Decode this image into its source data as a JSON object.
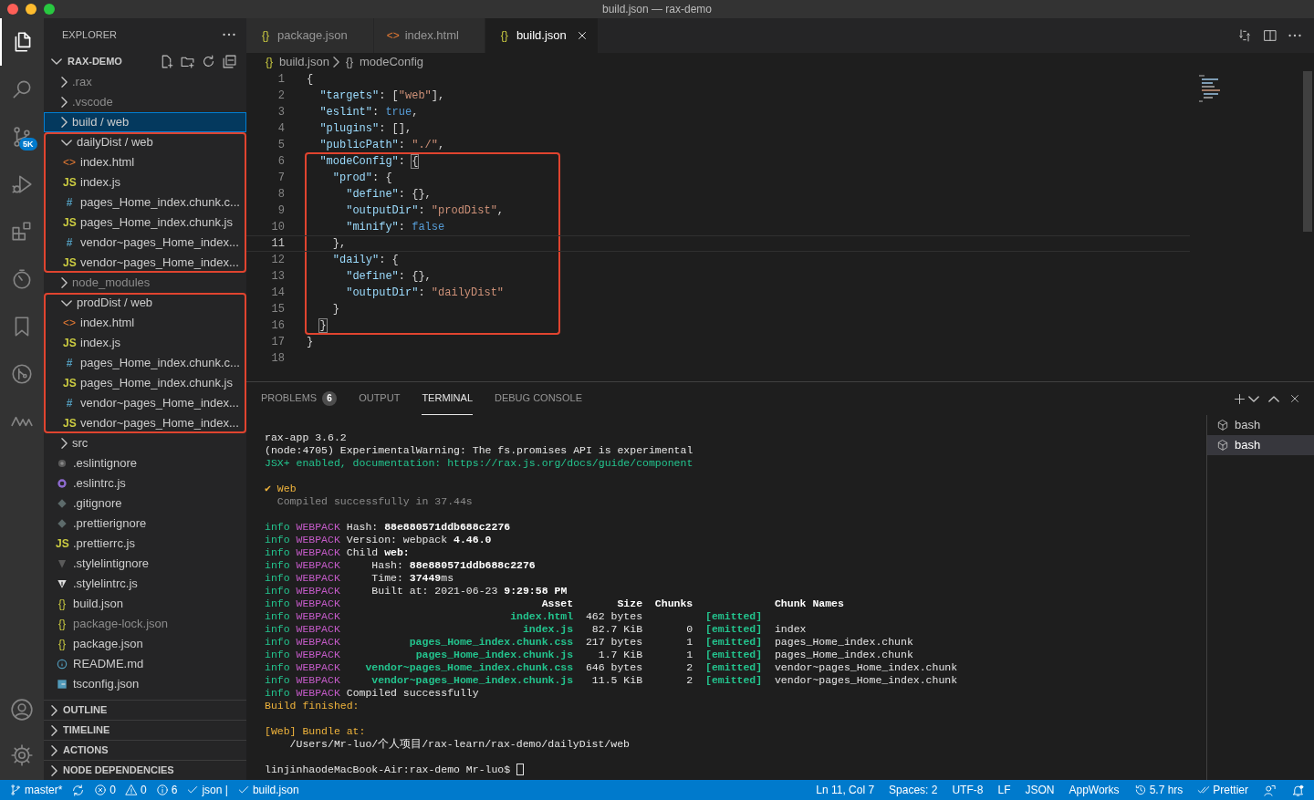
{
  "window": {
    "title": "build.json — rax-demo"
  },
  "activity_bar": {
    "items": [
      {
        "selected": true
      },
      {
        "selected": false
      },
      {
        "selected": false,
        "badge": "5K"
      },
      {
        "selected": false
      },
      {
        "selected": false
      },
      {
        "selected": false
      },
      {
        "selected": false
      },
      {
        "selected": false
      },
      {
        "selected": false
      }
    ]
  },
  "explorer": {
    "title": "EXPLORER",
    "project": {
      "name": "RAX-DEMO",
      "expanded": true
    },
    "tree": [
      {
        "kind": "folder",
        "name": ".rax",
        "expanded": false,
        "selected": false,
        "dimmed": true,
        "highlighted": false
      },
      {
        "kind": "folder",
        "name": ".vscode",
        "expanded": false,
        "selected": false,
        "dimmed": true,
        "highlighted": false
      },
      {
        "kind": "folder",
        "name": "build / web",
        "expanded": false,
        "selected": true,
        "dimmed": false,
        "highlighted": false
      },
      {
        "kind": "folder",
        "name": "dailyDist / web",
        "expanded": true,
        "selected": false,
        "dimmed": false,
        "highlighted": true,
        "children": [
          {
            "kind": "html",
            "name": "index.html",
            "glyph": "<>",
            "selected": false,
            "dimmed": false,
            "highlighted": false
          },
          {
            "kind": "js",
            "name": "index.js",
            "glyph": "JS",
            "selected": false,
            "dimmed": false,
            "highlighted": false
          },
          {
            "kind": "css",
            "name": "pages_Home_index.chunk.c...",
            "glyph": "#",
            "selected": false,
            "dimmed": false,
            "highlighted": false
          },
          {
            "kind": "js",
            "name": "pages_Home_index.chunk.js",
            "glyph": "JS",
            "selected": false,
            "dimmed": false,
            "highlighted": false
          },
          {
            "kind": "css",
            "name": "vendor~pages_Home_index...",
            "glyph": "#",
            "selected": false,
            "dimmed": false,
            "highlighted": false
          },
          {
            "kind": "js",
            "name": "vendor~pages_Home_index...",
            "glyph": "JS",
            "selected": false,
            "dimmed": false,
            "highlighted": false
          }
        ]
      },
      {
        "kind": "folder",
        "name": "node_modules",
        "expanded": false,
        "selected": false,
        "dimmed": true,
        "highlighted": false
      },
      {
        "kind": "folder",
        "name": "prodDist / web",
        "expanded": true,
        "selected": false,
        "dimmed": false,
        "highlighted": true,
        "children": [
          {
            "kind": "html",
            "name": "index.html",
            "glyph": "<>",
            "selected": false,
            "dimmed": false,
            "highlighted": false
          },
          {
            "kind": "js",
            "name": "index.js",
            "glyph": "JS",
            "selected": false,
            "dimmed": false,
            "highlighted": false
          },
          {
            "kind": "css",
            "name": "pages_Home_index.chunk.c...",
            "glyph": "#",
            "selected": false,
            "dimmed": false,
            "highlighted": false
          },
          {
            "kind": "js",
            "name": "pages_Home_index.chunk.js",
            "glyph": "JS",
            "selected": false,
            "dimmed": false,
            "highlighted": false
          },
          {
            "kind": "css",
            "name": "vendor~pages_Home_index...",
            "glyph": "#",
            "selected": false,
            "dimmed": false,
            "highlighted": false
          },
          {
            "kind": "js",
            "name": "vendor~pages_Home_index...",
            "glyph": "JS",
            "selected": false,
            "dimmed": false,
            "highlighted": false
          }
        ]
      },
      {
        "kind": "folder",
        "name": "src",
        "expanded": false,
        "selected": false,
        "dimmed": false,
        "highlighted": false
      },
      {
        "kind": "eslintignore",
        "name": ".eslintignore",
        "selected": false,
        "dimmed": false,
        "highlighted": false
      },
      {
        "kind": "eslint",
        "name": ".eslintrc.js",
        "selected": false,
        "dimmed": false,
        "highlighted": false
      },
      {
        "kind": "ignore",
        "name": ".gitignore",
        "selected": false,
        "dimmed": false,
        "highlighted": false
      },
      {
        "kind": "ignore",
        "name": ".prettierignore",
        "selected": false,
        "dimmed": false,
        "highlighted": false
      },
      {
        "kind": "js",
        "name": ".prettierrc.js",
        "glyph": "JS",
        "selected": false,
        "dimmed": false,
        "highlighted": false
      },
      {
        "kind": "stylelintignore",
        "name": ".stylelintignore",
        "selected": false,
        "dimmed": false,
        "highlighted": false
      },
      {
        "kind": "stylelint",
        "name": ".stylelintrc.js",
        "selected": false,
        "dimmed": false,
        "highlighted": false
      },
      {
        "kind": "json",
        "name": "build.json",
        "glyph": "{}",
        "selected": false,
        "dimmed": false,
        "highlighted": false
      },
      {
        "kind": "json",
        "name": "package-lock.json",
        "glyph": "{}",
        "selected": false,
        "dimmed": true,
        "highlighted": false
      },
      {
        "kind": "json",
        "name": "package.json",
        "glyph": "{}",
        "selected": false,
        "dimmed": false,
        "highlighted": false
      },
      {
        "kind": "readme",
        "name": "README.md",
        "selected": false,
        "dimmed": false,
        "highlighted": false
      },
      {
        "kind": "ts",
        "name": "tsconfig.json",
        "selected": false,
        "dimmed": false,
        "highlighted": false
      }
    ],
    "sections": [
      {
        "label": "OUTLINE",
        "expanded": false
      },
      {
        "label": "TIMELINE",
        "expanded": false
      },
      {
        "label": "ACTIONS",
        "expanded": false
      },
      {
        "label": "NODE DEPENDENCIES",
        "expanded": false
      }
    ]
  },
  "tabs": [
    {
      "label": "package.json",
      "kind": "json",
      "glyph": "{}",
      "selected": false
    },
    {
      "label": "index.html",
      "kind": "html",
      "glyph": "<>",
      "selected": false
    },
    {
      "label": "build.json",
      "kind": "json",
      "glyph": "{}",
      "selected": true
    }
  ],
  "breadcrumb": [
    {
      "label": "build.json",
      "kind": "json",
      "glyph": "{}"
    },
    {
      "label": "modeConfig",
      "kind": "object",
      "glyph": "{}"
    }
  ],
  "code": [
    {
      "number": "1",
      "current": false,
      "highlighted": false,
      "tokens": [
        {
          "t": "{",
          "kind": "p"
        }
      ]
    },
    {
      "number": "2",
      "current": false,
      "highlighted": false,
      "tokens": [
        {
          "t": "\"targets\"",
          "kind": "key"
        },
        {
          "t": ": [",
          "kind": "p"
        },
        {
          "t": "\"web\"",
          "kind": "str"
        },
        {
          "t": "],",
          "kind": "p"
        }
      ]
    },
    {
      "number": "3",
      "current": false,
      "highlighted": false,
      "tokens": [
        {
          "t": "\"eslint\"",
          "kind": "key"
        },
        {
          "t": ":",
          "kind": "p"
        },
        {
          "t": "true",
          "kind": "bool"
        },
        {
          "t": ",",
          "kind": "p"
        }
      ]
    },
    {
      "number": "4",
      "current": false,
      "highlighted": false,
      "tokens": [
        {
          "t": "\"plugins\"",
          "kind": "key"
        },
        {
          "t": ": [],",
          "kind": "p"
        }
      ]
    },
    {
      "number": "5",
      "current": false,
      "highlighted": false,
      "tokens": [
        {
          "t": "\"publicPath\"",
          "kind": "key"
        },
        {
          "t": ":",
          "kind": "p"
        },
        {
          "t": "\"./\"",
          "kind": "str"
        },
        {
          "t": ",",
          "kind": "p"
        }
      ]
    },
    {
      "number": "6",
      "current": false,
      "highlighted": true,
      "tokens": [
        {
          "t": "\"modeConfig\"",
          "kind": "key"
        },
        {
          "t": ":",
          "kind": "p"
        },
        {
          "t": "{",
          "kind": "match"
        }
      ]
    },
    {
      "number": "7",
      "current": false,
      "highlighted": true,
      "tokens": [
        {
          "t": "\"prod\"",
          "kind": "key"
        },
        {
          "t": ": {",
          "kind": "p"
        }
      ]
    },
    {
      "number": "8",
      "current": false,
      "highlighted": true,
      "tokens": [
        {
          "t": "\"define\"",
          "kind": "key"
        },
        {
          "t": ": {},",
          "kind": "p"
        }
      ]
    },
    {
      "number": "9",
      "current": false,
      "highlighted": true,
      "tokens": [
        {
          "t": "\"outputDir\"",
          "kind": "key"
        },
        {
          "t": ":",
          "kind": "p"
        },
        {
          "t": "\"prodDist\"",
          "kind": "str"
        },
        {
          "t": ",",
          "kind": "p"
        }
      ]
    },
    {
      "number": "10",
      "current": false,
      "highlighted": true,
      "tokens": [
        {
          "t": "\"minify\"",
          "kind": "key"
        },
        {
          "t": ":",
          "kind": "p"
        },
        {
          "t": "false",
          "kind": "bool"
        }
      ]
    },
    {
      "number": "11",
      "current": true,
      "highlighted": true,
      "tokens": [
        {
          "t": "},",
          "kind": "p"
        }
      ]
    },
    {
      "number": "12",
      "current": false,
      "highlighted": true,
      "tokens": [
        {
          "t": "\"daily\"",
          "kind": "key"
        },
        {
          "t": ": {",
          "kind": "p"
        }
      ]
    },
    {
      "number": "13",
      "current": false,
      "highlighted": true,
      "tokens": [
        {
          "t": "\"define\"",
          "kind": "key"
        },
        {
          "t": ": {},",
          "kind": "p"
        }
      ]
    },
    {
      "number": "14",
      "current": false,
      "highlighted": true,
      "tokens": [
        {
          "t": "\"outputDir\"",
          "kind": "key"
        },
        {
          "t": ":",
          "kind": "p"
        },
        {
          "t": "\"dailyDist\"",
          "kind": "str"
        }
      ]
    },
    {
      "number": "15",
      "current": false,
      "highlighted": true,
      "tokens": [
        {
          "t": "}",
          "kind": "p"
        }
      ]
    },
    {
      "number": "16",
      "current": false,
      "highlighted": true,
      "tokens": [
        {
          "t": "}",
          "kind": "match"
        }
      ]
    },
    {
      "number": "17",
      "current": false,
      "highlighted": false,
      "tokens": [
        {
          "t": "}",
          "kind": "p"
        }
      ]
    },
    {
      "number": "18",
      "current": false,
      "highlighted": false
    }
  ],
  "panel": {
    "tabs": [
      {
        "label": "PROBLEMS",
        "badge": "6",
        "selected": false
      },
      {
        "label": "OUTPUT",
        "selected": false
      },
      {
        "label": "TERMINAL",
        "selected": true
      },
      {
        "label": "DEBUG CONSOLE",
        "selected": false
      }
    ],
    "terminal": [
      {
        "kind": "text",
        "segments": [
          {
            "text": "rax-app 3.6.2",
            "kind": "plain"
          }
        ]
      },
      {
        "kind": "text",
        "segments": [
          {
            "text": "(node:4705) ExperimentalWarning: The fs.promises API is experimental",
            "kind": "plain"
          }
        ]
      },
      {
        "kind": "text",
        "segments": [
          {
            "text": "JSX+ enabled, documentation: https://rax.js.org/docs/guide/component",
            "kind": "accent"
          }
        ]
      },
      {
        "kind": "blank"
      },
      {
        "kind": "text",
        "segments": [
          {
            "text": "✔ Web",
            "kind": "yellow"
          }
        ]
      },
      {
        "kind": "note",
        "segments": [
          {
            "text": "Compiled successfully in 37.44s",
            "kind": "dim"
          }
        ]
      },
      {
        "kind": "blank"
      },
      {
        "kind": "text",
        "segments": [
          {
            "text": "info",
            "kind": "info"
          },
          {
            "text": "WEBPACK",
            "kind": "webpack"
          },
          {
            "text": "Hash:",
            "kind": "plain"
          },
          {
            "text": "88e880571ddb688c2276",
            "kind": "bold"
          }
        ]
      },
      {
        "kind": "text",
        "segments": [
          {
            "text": "info",
            "kind": "info"
          },
          {
            "text": "WEBPACK",
            "kind": "webpack"
          },
          {
            "text": "Version: webpack",
            "kind": "plain"
          },
          {
            "text": "4.46.0",
            "kind": "bold"
          }
        ]
      },
      {
        "kind": "text",
        "segments": [
          {
            "text": "info",
            "kind": "info"
          },
          {
            "text": "WEBPACK",
            "kind": "webpack"
          },
          {
            "text": "Child",
            "kind": "plain"
          },
          {
            "text": "web:",
            "kind": "bold"
          }
        ]
      },
      {
        "kind": "text",
        "segments": [
          {
            "text": "info",
            "kind": "info"
          },
          {
            "text": "WEBPACK",
            "kind": "webpack"
          },
          {
            "text": "Hash:",
            "kind": "field"
          },
          {
            "text": "88e880571ddb688c2276",
            "kind": "bold"
          }
        ]
      },
      {
        "kind": "text",
        "segments": [
          {
            "text": "info",
            "kind": "info"
          },
          {
            "text": "WEBPACK",
            "kind": "webpack"
          },
          {
            "text": "Time:",
            "kind": "field"
          },
          {
            "text": "37449",
            "kind": "bold"
          },
          {
            "text": "ms",
            "kind": "join"
          }
        ]
      },
      {
        "kind": "text",
        "segments": [
          {
            "text": "info",
            "kind": "info"
          },
          {
            "text": "WEBPACK",
            "kind": "webpack"
          },
          {
            "text": "Built at: 2021-06-23",
            "kind": "field"
          },
          {
            "text": "9:29:58 PM",
            "kind": "bold"
          }
        ]
      },
      {
        "kind": "table_header",
        "prefix": [
          {
            "text": "info",
            "kind": "info"
          },
          {
            "text": "WEBPACK",
            "kind": "webpack"
          }
        ],
        "asset": "Asset",
        "size": "Size",
        "chunks": "Chunks",
        "chunk_name": "Chunk Names"
      },
      {
        "kind": "table_row",
        "prefix": [
          {
            "text": "info",
            "kind": "info"
          },
          {
            "text": "WEBPACK",
            "kind": "webpack"
          }
        ],
        "asset": "index.html",
        "size": "462 bytes",
        "status": "[emitted]"
      },
      {
        "kind": "table_row",
        "prefix": [
          {
            "text": "info",
            "kind": "info"
          },
          {
            "text": "WEBPACK",
            "kind": "webpack"
          }
        ],
        "asset": "index.js",
        "size": "82.7 KiB",
        "chunks": "0",
        "status": "[emitted]",
        "chunk_name": "index"
      },
      {
        "kind": "table_row",
        "prefix": [
          {
            "text": "info",
            "kind": "info"
          },
          {
            "text": "WEBPACK",
            "kind": "webpack"
          }
        ],
        "asset": "pages_Home_index.chunk.css",
        "size": "217 bytes",
        "chunks": "1",
        "status": "[emitted]",
        "chunk_name": "pages_Home_index.chunk"
      },
      {
        "kind": "table_row",
        "prefix": [
          {
            "text": "info",
            "kind": "info"
          },
          {
            "text": "WEBPACK",
            "kind": "webpack"
          }
        ],
        "asset": "pages_Home_index.chunk.js",
        "size": "1.7 KiB",
        "chunks": "1",
        "status": "[emitted]",
        "chunk_name": "pages_Home_index.chunk"
      },
      {
        "kind": "table_row",
        "prefix": [
          {
            "text": "info",
            "kind": "info"
          },
          {
            "text": "WEBPACK",
            "kind": "webpack"
          }
        ],
        "asset": "vendor~pages_Home_index.chunk.css",
        "size": "646 bytes",
        "chunks": "2",
        "status": "[emitted]",
        "chunk_name": "vendor~pages_Home_index.chunk"
      },
      {
        "kind": "table_row",
        "prefix": [
          {
            "text": "info",
            "kind": "info"
          },
          {
            "text": "WEBPACK",
            "kind": "webpack"
          }
        ],
        "asset": "vendor~pages_Home_index.chunk.js",
        "size": "11.5 KiB",
        "chunks": "2",
        "status": "[emitted]",
        "chunk_name": "vendor~pages_Home_index.chunk"
      },
      {
        "kind": "text",
        "segments": [
          {
            "text": "info",
            "kind": "info"
          },
          {
            "text": "WEBPACK",
            "kind": "webpack"
          },
          {
            "text": "Compiled successfully",
            "kind": "plain"
          }
        ]
      },
      {
        "kind": "text",
        "segments": [
          {
            "text": "Build finished:",
            "kind": "yellow"
          }
        ]
      },
      {
        "kind": "blank"
      },
      {
        "kind": "text",
        "segments": [
          {
            "text": "[Web] Bundle at:",
            "kind": "yellow"
          }
        ]
      },
      {
        "kind": "path",
        "segments": [
          {
            "text": "/Users/Mr-luo/个人项目/rax-learn/rax-demo/dailyDist/web",
            "kind": "plain"
          }
        ]
      },
      {
        "kind": "blank"
      },
      {
        "kind": "prompt",
        "segments": [
          {
            "text": "linjinhaodeMacBook-Air:rax-demo Mr-luo$",
            "kind": "plain"
          }
        ]
      }
    ],
    "sessions": [
      {
        "label": "bash",
        "selected": false
      },
      {
        "label": "bash",
        "selected": true
      }
    ]
  },
  "status_bar": {
    "left": [
      {
        "kind": "branch",
        "text": "master*"
      },
      {
        "kind": "sync"
      },
      {
        "kind": "error",
        "text": "0"
      },
      {
        "kind": "warning",
        "text": "0"
      },
      {
        "kind": "info",
        "text": "6"
      },
      {
        "kind": "check",
        "text": "json |"
      },
      {
        "kind": "check",
        "text": "build.json"
      }
    ],
    "right": [
      {
        "kind": "text",
        "text": "Ln 11, Col 7"
      },
      {
        "kind": "text",
        "text": "Spaces: 2"
      },
      {
        "kind": "text",
        "text": "UTF-8"
      },
      {
        "kind": "text",
        "text": "LF"
      },
      {
        "kind": "text",
        "text": "JSON"
      },
      {
        "kind": "text",
        "text": "AppWorks"
      },
      {
        "kind": "history",
        "text": "5.7 hrs"
      },
      {
        "kind": "double-check",
        "text": "Prettier"
      },
      {
        "kind": "feedback"
      },
      {
        "kind": "bell"
      }
    ]
  }
}
